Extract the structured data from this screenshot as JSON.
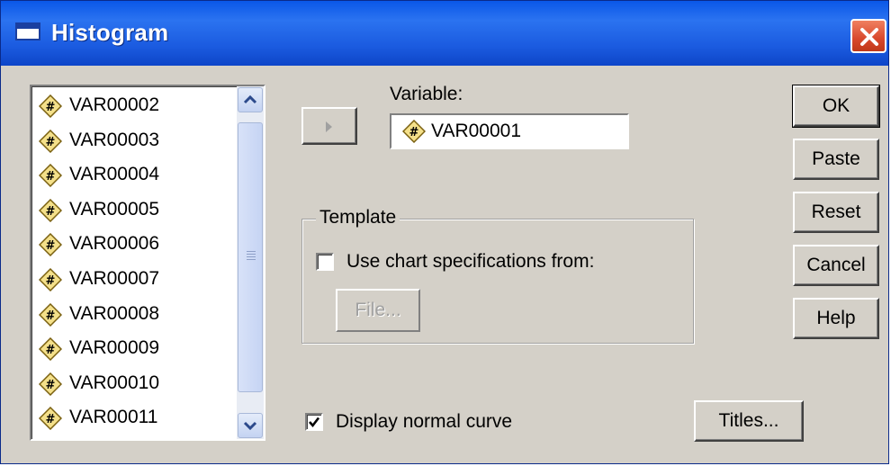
{
  "window": {
    "title": "Histogram",
    "close_icon": "close-icon",
    "accent": "#0a57e8"
  },
  "source_list": {
    "items": [
      {
        "label": "VAR00002",
        "icon": "scale-variable-icon"
      },
      {
        "label": "VAR00003",
        "icon": "scale-variable-icon"
      },
      {
        "label": "VAR00004",
        "icon": "scale-variable-icon"
      },
      {
        "label": "VAR00005",
        "icon": "scale-variable-icon"
      },
      {
        "label": "VAR00006",
        "icon": "scale-variable-icon"
      },
      {
        "label": "VAR00007",
        "icon": "scale-variable-icon"
      },
      {
        "label": "VAR00008",
        "icon": "scale-variable-icon"
      },
      {
        "label": "VAR00009",
        "icon": "scale-variable-icon"
      },
      {
        "label": "VAR00010",
        "icon": "scale-variable-icon"
      },
      {
        "label": "VAR00011",
        "icon": "scale-variable-icon"
      }
    ]
  },
  "variable": {
    "label": "Variable:",
    "value": "VAR00001"
  },
  "template": {
    "legend": "Template",
    "checkbox_label": "Use chart specifications from:",
    "checked": false,
    "file_button": "File..."
  },
  "normal_curve": {
    "label": "Display normal curve",
    "checked": true
  },
  "buttons": {
    "ok": "OK",
    "paste": "Paste",
    "reset": "Reset",
    "cancel": "Cancel",
    "help": "Help",
    "titles": "Titles..."
  }
}
